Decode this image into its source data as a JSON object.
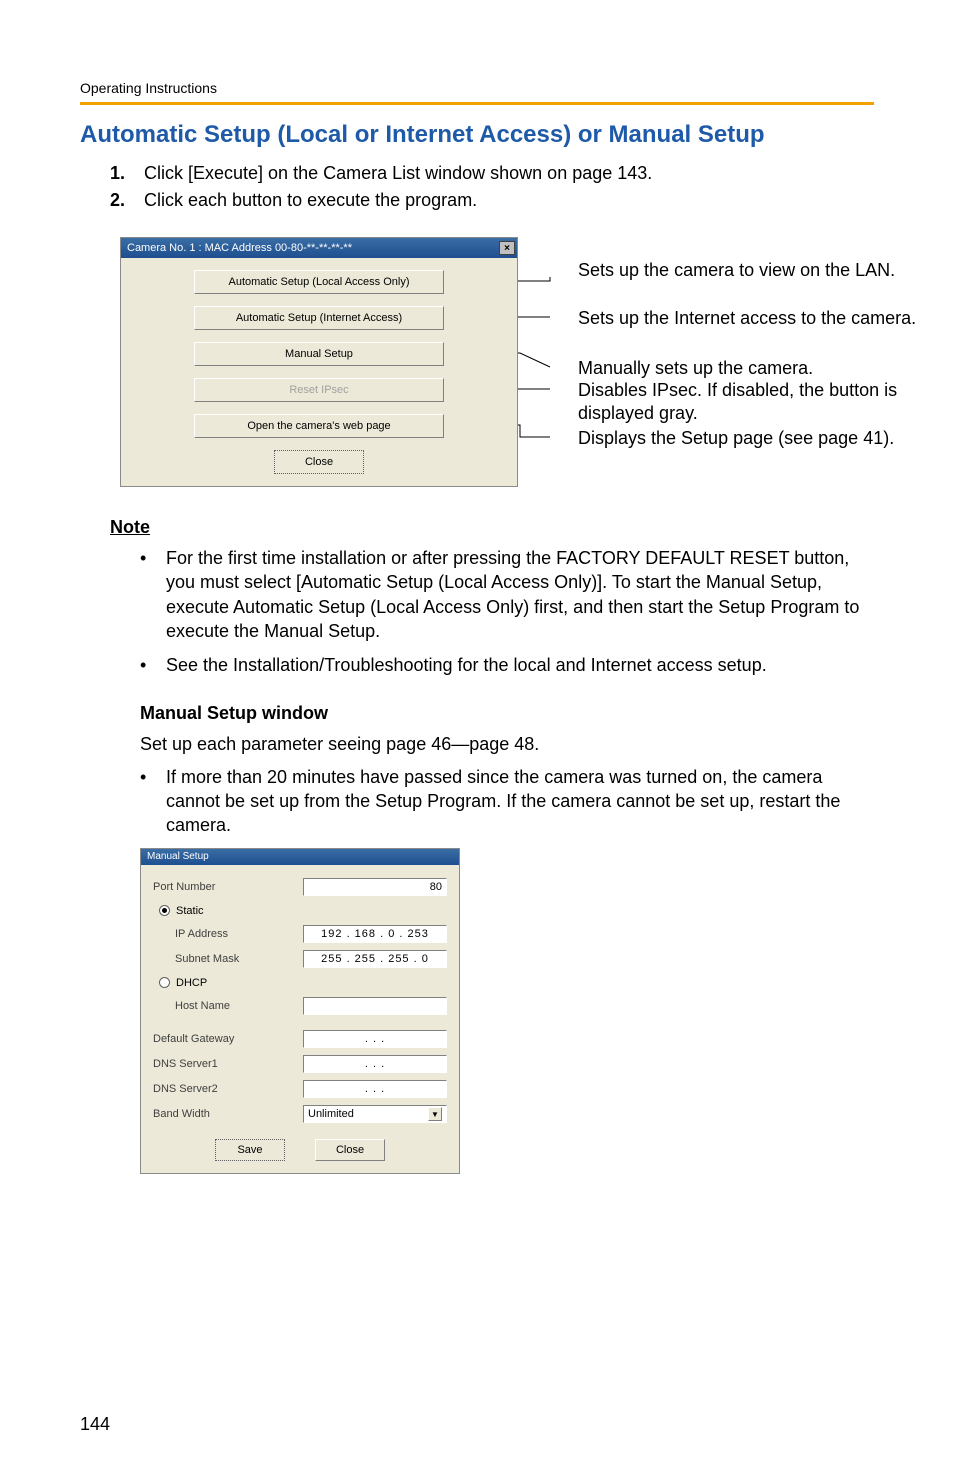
{
  "header": {
    "title": "Operating Instructions"
  },
  "section": {
    "title": "Automatic Setup (Local or Internet Access) or Manual Setup"
  },
  "steps": {
    "s1": {
      "num": "1.",
      "text": "Click [Execute] on the Camera List window shown on page 143."
    },
    "s2": {
      "num": "2.",
      "text": "Click each button to execute the program."
    }
  },
  "win1": {
    "title": "Camera No. 1 : MAC Address 00-80-**-**-**-**",
    "btn_local": "Automatic Setup (Local Access Only)",
    "btn_internet": "Automatic Setup (Internet Access)",
    "btn_manual": "Manual Setup",
    "btn_reset": "Reset IPsec",
    "btn_open": "Open the camera's web page",
    "btn_close": "Close"
  },
  "annotations": {
    "a1": "Sets up the camera to view on the LAN.",
    "a2": "Sets up the Internet access to the camera.",
    "a3": "Manually sets up the camera.",
    "a4": "Disables IPsec. If disabled, the button is displayed gray.",
    "a5": "Displays the Setup page (see page 41)."
  },
  "note": {
    "heading": "Note"
  },
  "note_bullets": {
    "b1": "For the first time installation or after pressing the FACTORY DEFAULT RESET button, you must select [Automatic Setup (Local Access Only)]. To start the Manual Setup, execute Automatic Setup (Local Access Only) first, and then start the Setup Program to execute the Manual Setup.",
    "b2": "See the Installation/Troubleshooting for the local and Internet access setup."
  },
  "manual_section": {
    "heading": "Manual Setup window",
    "desc": "Set up each parameter seeing page 46—page 48.",
    "bullet": "If more than 20 minutes have passed since the camera was turned on, the camera cannot be set up from the Setup Program. If the camera cannot be set up, restart the camera."
  },
  "manual_win": {
    "title": "Manual Setup",
    "port_label": "Port Number",
    "port_value": "80",
    "static_label": "Static",
    "ip_label": "IP Address",
    "ip_value": "192 . 168 .  0  . 253",
    "subnet_label": "Subnet Mask",
    "subnet_value": "255 . 255 . 255 .  0",
    "dhcp_label": "DHCP",
    "host_label": "Host Name",
    "host_value": "",
    "gateway_label": "Default Gateway",
    "gateway_value": ".        .        .",
    "dns1_label": "DNS Server1",
    "dns1_value": ".        .        .",
    "dns2_label": "DNS Server2",
    "dns2_value": ".        .        .",
    "bw_label": "Band Width",
    "bw_value": "Unlimited",
    "save": "Save",
    "close": "Close"
  },
  "page": {
    "number": "144"
  }
}
